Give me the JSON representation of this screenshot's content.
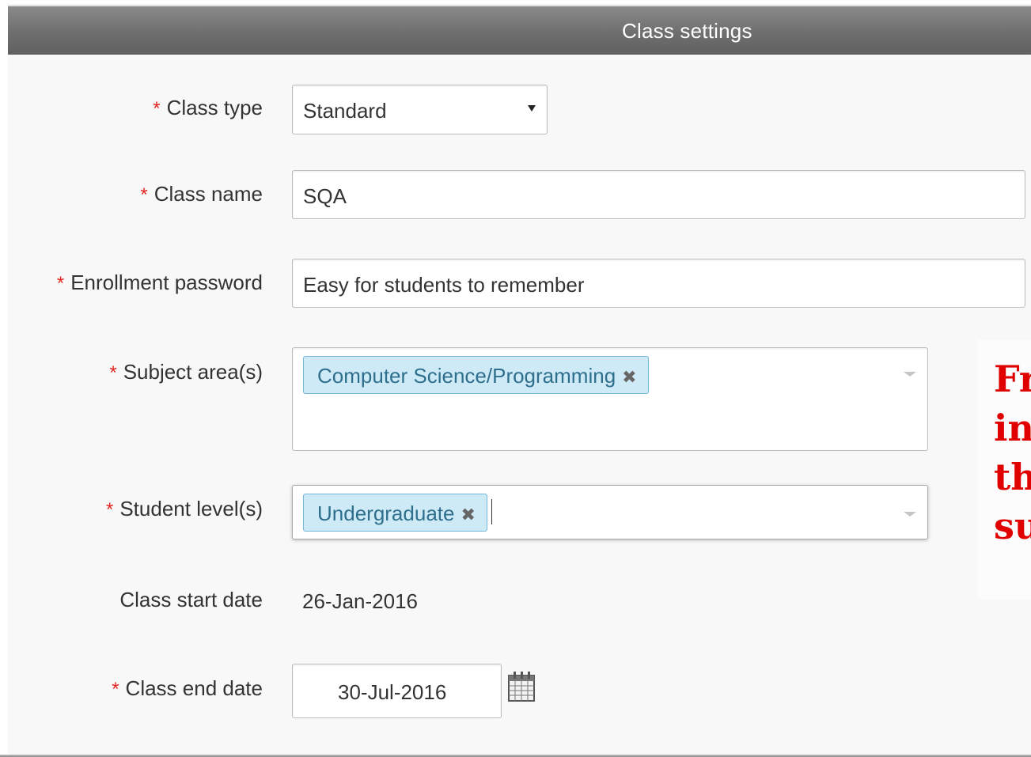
{
  "header": {
    "title": "Class settings"
  },
  "required_marker": "*",
  "form": {
    "class_type": {
      "label": "Class type",
      "value": "Standard"
    },
    "class_name": {
      "label": "Class name",
      "value": "SQA"
    },
    "enrollment_password": {
      "label": "Enrollment password",
      "value": "Easy for students to remember"
    },
    "subject_areas": {
      "label": "Subject area(s)",
      "tags": [
        "Computer Science/Programming"
      ],
      "remove_glyph": "✖"
    },
    "student_levels": {
      "label": "Student level(s)",
      "tags": [
        "Undergraduate"
      ],
      "remove_glyph": "✖"
    },
    "class_start_date": {
      "label": "Class start date",
      "value": "26-Jan-2016"
    },
    "class_end_date": {
      "label": "Class end date",
      "value": "30-Jul-2016"
    }
  },
  "side_note": {
    "lines": [
      "Fr",
      "in",
      "th",
      "su"
    ],
    "color": "#e00000"
  },
  "icons": {
    "class_type_caret": "caret-down-icon",
    "subject_caret": "chevron-down-icon",
    "level_caret": "chevron-down-icon",
    "end_date_picker": "calendar-icon"
  },
  "colors": {
    "header_bg": "#6f6f6f",
    "required": "#e2261e",
    "tag_bg": "#cfeaf7",
    "tag_border": "#73b6d6",
    "tag_text": "#2d6f8c"
  }
}
